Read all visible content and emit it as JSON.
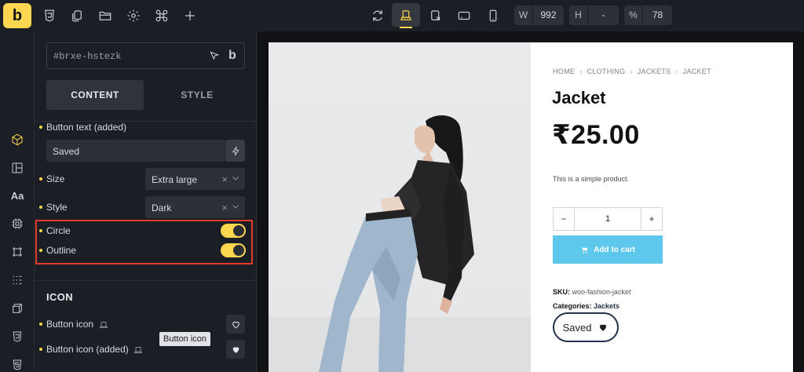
{
  "app": {
    "logo_letter": "b",
    "accent_color": "#ffd64f"
  },
  "toolbar": {
    "left_icons": [
      "css3-icon",
      "copy-icon",
      "folder-icon",
      "gear-icon",
      "command-icon",
      "plus-icon"
    ],
    "center_icons": [
      "refresh-icon",
      "desktop-breakpoint-icon",
      "tablet-landscape-icon",
      "tablet-portrait-icon",
      "mobile-icon"
    ],
    "width": {
      "key": "W",
      "value": "992"
    },
    "height": {
      "key": "H",
      "value": "-"
    },
    "zoom": {
      "key": "%",
      "value": "78"
    }
  },
  "rail": {
    "icons": [
      "cube-icon",
      "layout-icon",
      "typography-icon",
      "component-icon",
      "frame-icon",
      "grid-icon",
      "3d-box-icon",
      "css3-icon",
      "html5-icon"
    ]
  },
  "panel": {
    "element_id": "#brxe-hstezk",
    "tabs": {
      "content": "CONTENT",
      "style": "STYLE"
    },
    "button_text": {
      "label": "Button text (added)",
      "value": "Saved"
    },
    "size": {
      "label": "Size",
      "value": "Extra large",
      "clear": "×"
    },
    "style": {
      "label": "Style",
      "value": "Dark",
      "clear": "×"
    },
    "circle": {
      "label": "Circle",
      "on": true
    },
    "outline": {
      "label": "Outline",
      "on": true
    },
    "icon_section": {
      "title": "ICON"
    },
    "button_icon": {
      "label": "Button icon"
    },
    "button_icon_added": {
      "label": "Button icon (added)"
    },
    "tooltip": "Button icon"
  },
  "product": {
    "breadcrumb": [
      "HOME",
      "CLOTHING",
      "JACKETS",
      "JACKET"
    ],
    "breadcrumb_sep": "›",
    "title": "Jacket",
    "price": "₹25.00",
    "description": "This is a simple product.",
    "quantity": {
      "minus": "−",
      "value": "1",
      "plus": "+"
    },
    "add_to_cart": "Add to cart",
    "sku_label": "SKU:",
    "sku_value": "woo-fashion-jacket",
    "categories_label": "Categories:",
    "categories_value": "Jackets",
    "saved_button": "Saved",
    "cart_color": "#5ec7ec"
  }
}
